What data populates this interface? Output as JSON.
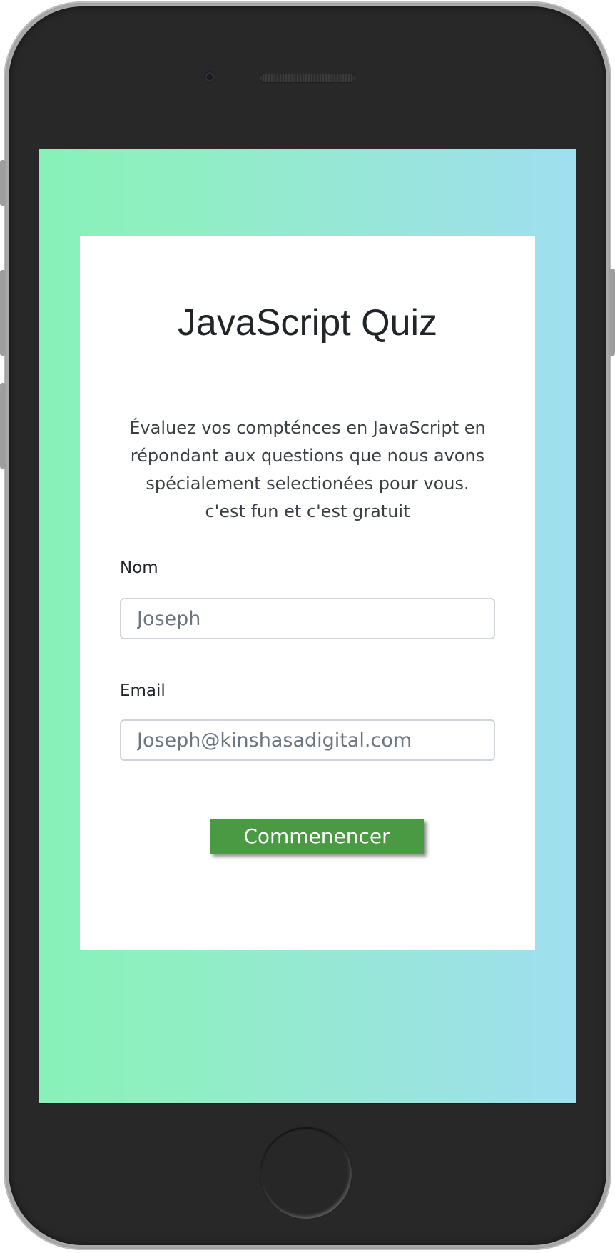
{
  "quiz": {
    "title": "JavaScript Quiz",
    "description_lines": [
      "Évaluez vos compténces en JavaScript en",
      "répondant aux questions que nous avons",
      "spécialement selectionées pour vous.",
      "c'est fun et c'est gratuit"
    ],
    "name_label": "Nom",
    "name_placeholder": "Joseph",
    "email_label": "Email",
    "email_placeholder": "Joseph@kinshasadigital.com",
    "start_label": "Commenencer"
  },
  "colors": {
    "gradient_start": "#87f1b9",
    "gradient_end": "#a0dff0",
    "button": "#4a9a43",
    "phone_body": "#282828",
    "phone_frame": "#ababab"
  }
}
